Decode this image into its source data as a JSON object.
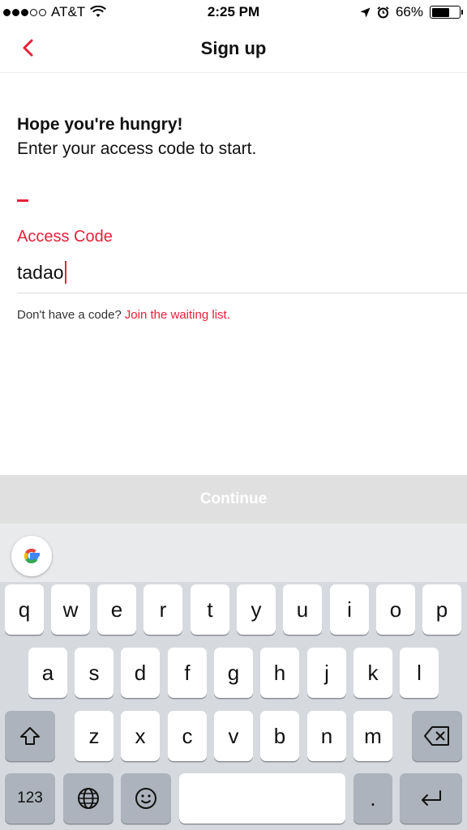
{
  "status_bar": {
    "carrier": "AT&T",
    "time": "2:25 PM",
    "battery_percent": "66%",
    "battery_level": 0.66,
    "signal_bars_filled": 3,
    "signal_bars_total": 5
  },
  "nav": {
    "title": "Sign up",
    "back_icon": "chevron-left-icon"
  },
  "content": {
    "headline": "Hope you're hungry!",
    "subline": "Enter your access code to start.",
    "field_label": "Access Code",
    "field_value": "tadao",
    "helper_text": "Don't have a code?",
    "helper_link": "Join the waiting list."
  },
  "continue_label": "Continue",
  "colors": {
    "accent": "#e8203a",
    "continue_bg": "#e0e0e0",
    "keyboard_bg": "#d6d9de"
  },
  "keyboard": {
    "row1": [
      "q",
      "w",
      "e",
      "r",
      "t",
      "y",
      "u",
      "i",
      "o",
      "p"
    ],
    "row2": [
      "a",
      "s",
      "d",
      "f",
      "g",
      "h",
      "j",
      "k",
      "l"
    ],
    "row3": [
      "z",
      "x",
      "c",
      "v",
      "b",
      "n",
      "m"
    ],
    "numbers_label": "123",
    "period_label": "."
  }
}
